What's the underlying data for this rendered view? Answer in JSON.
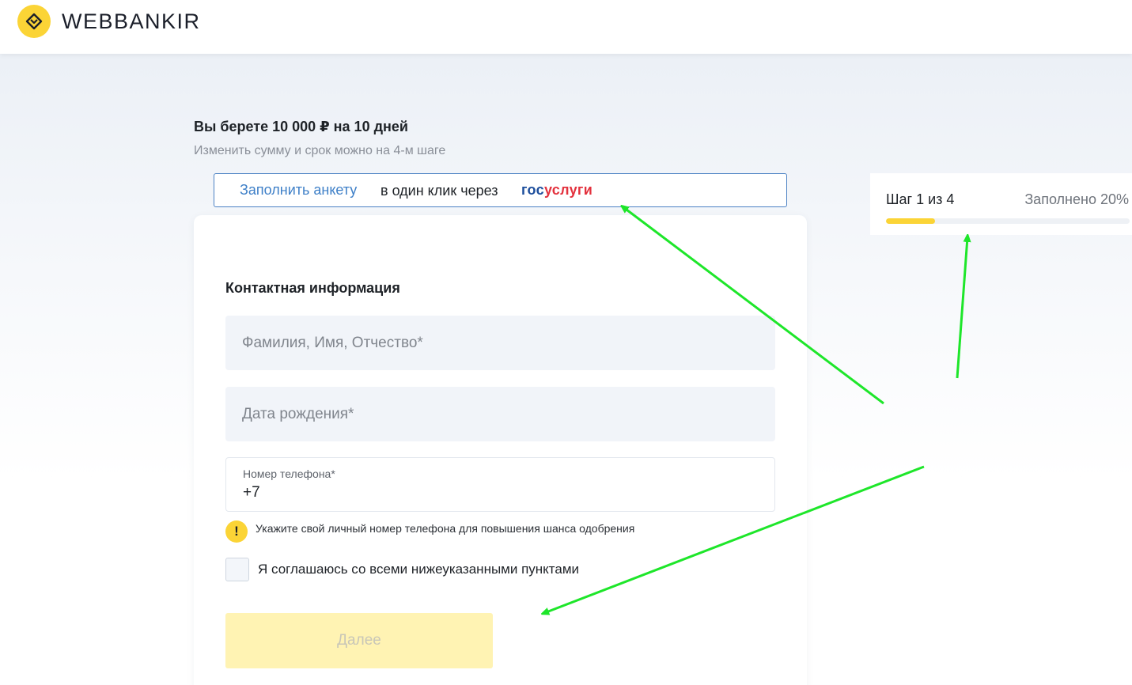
{
  "header": {
    "logo_text": "WEBBANKIR",
    "logo_icon": "diamond-heart-icon"
  },
  "summary": {
    "title": "Вы берете 10 000 ₽ на 10 дней",
    "subtitle": "Изменить сумму и срок можно на 4-м шаге"
  },
  "gosuslugi": {
    "link_text": "Заполнить анкету",
    "text": "в один клик через",
    "logo_part1": "гос",
    "logo_part2": "услуги"
  },
  "form": {
    "section_title": "Контактная информация",
    "fio_placeholder": "Фамилия, Имя, Отчество*",
    "dob_placeholder": "Дата рождения*",
    "phone_label": "Номер телефона*",
    "phone_value": "+7",
    "hint_icon": "exclamation-icon",
    "hint_glyph": "!",
    "hint_text": "Укажите свой личный номер телефона для повышения шанса одобрения",
    "agree_label": "Я соглашаюсь со всеми нижеуказанными пунктами",
    "next_label": "Далее"
  },
  "progress": {
    "step_text": "Шаг 1 из 4",
    "filled_text": "Заполнено 20%",
    "filled_fraction": 0.2
  },
  "colors": {
    "accent_yellow": "#fbd436",
    "link_blue": "#3f80c8",
    "annotation_green": "#1ee62a"
  }
}
